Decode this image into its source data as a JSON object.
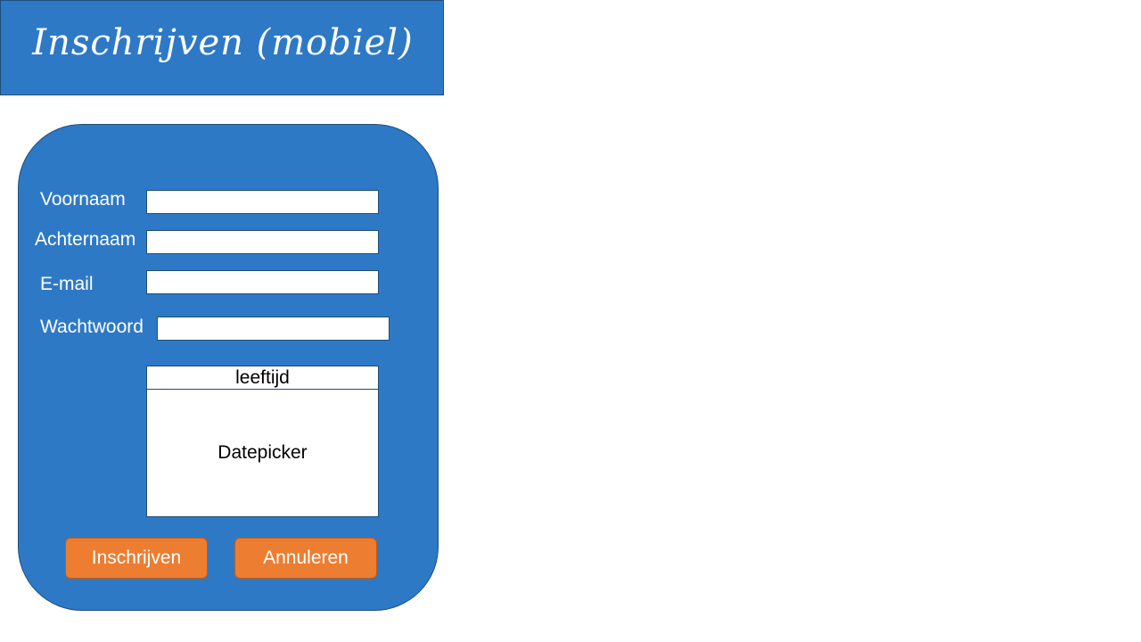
{
  "header": {
    "title": "Inschrijven (mobiel)"
  },
  "form": {
    "fields": [
      {
        "label": "Voornaam",
        "value": "",
        "placeholder": ""
      },
      {
        "label": "Achternaam",
        "value": "",
        "placeholder": ""
      },
      {
        "label": "E-mail",
        "value": "",
        "placeholder": ""
      },
      {
        "label": "Wachtwoord",
        "value": "",
        "placeholder": ""
      }
    ],
    "age": {
      "label": "leeftijd",
      "widget": "Datepicker"
    }
  },
  "buttons": {
    "submit_label": "Inschrijven",
    "cancel_label": "Annuleren"
  },
  "colors": {
    "primary_blue": "#2e79c6",
    "button_orange": "#ed7d31",
    "border": "#1f4e79"
  }
}
